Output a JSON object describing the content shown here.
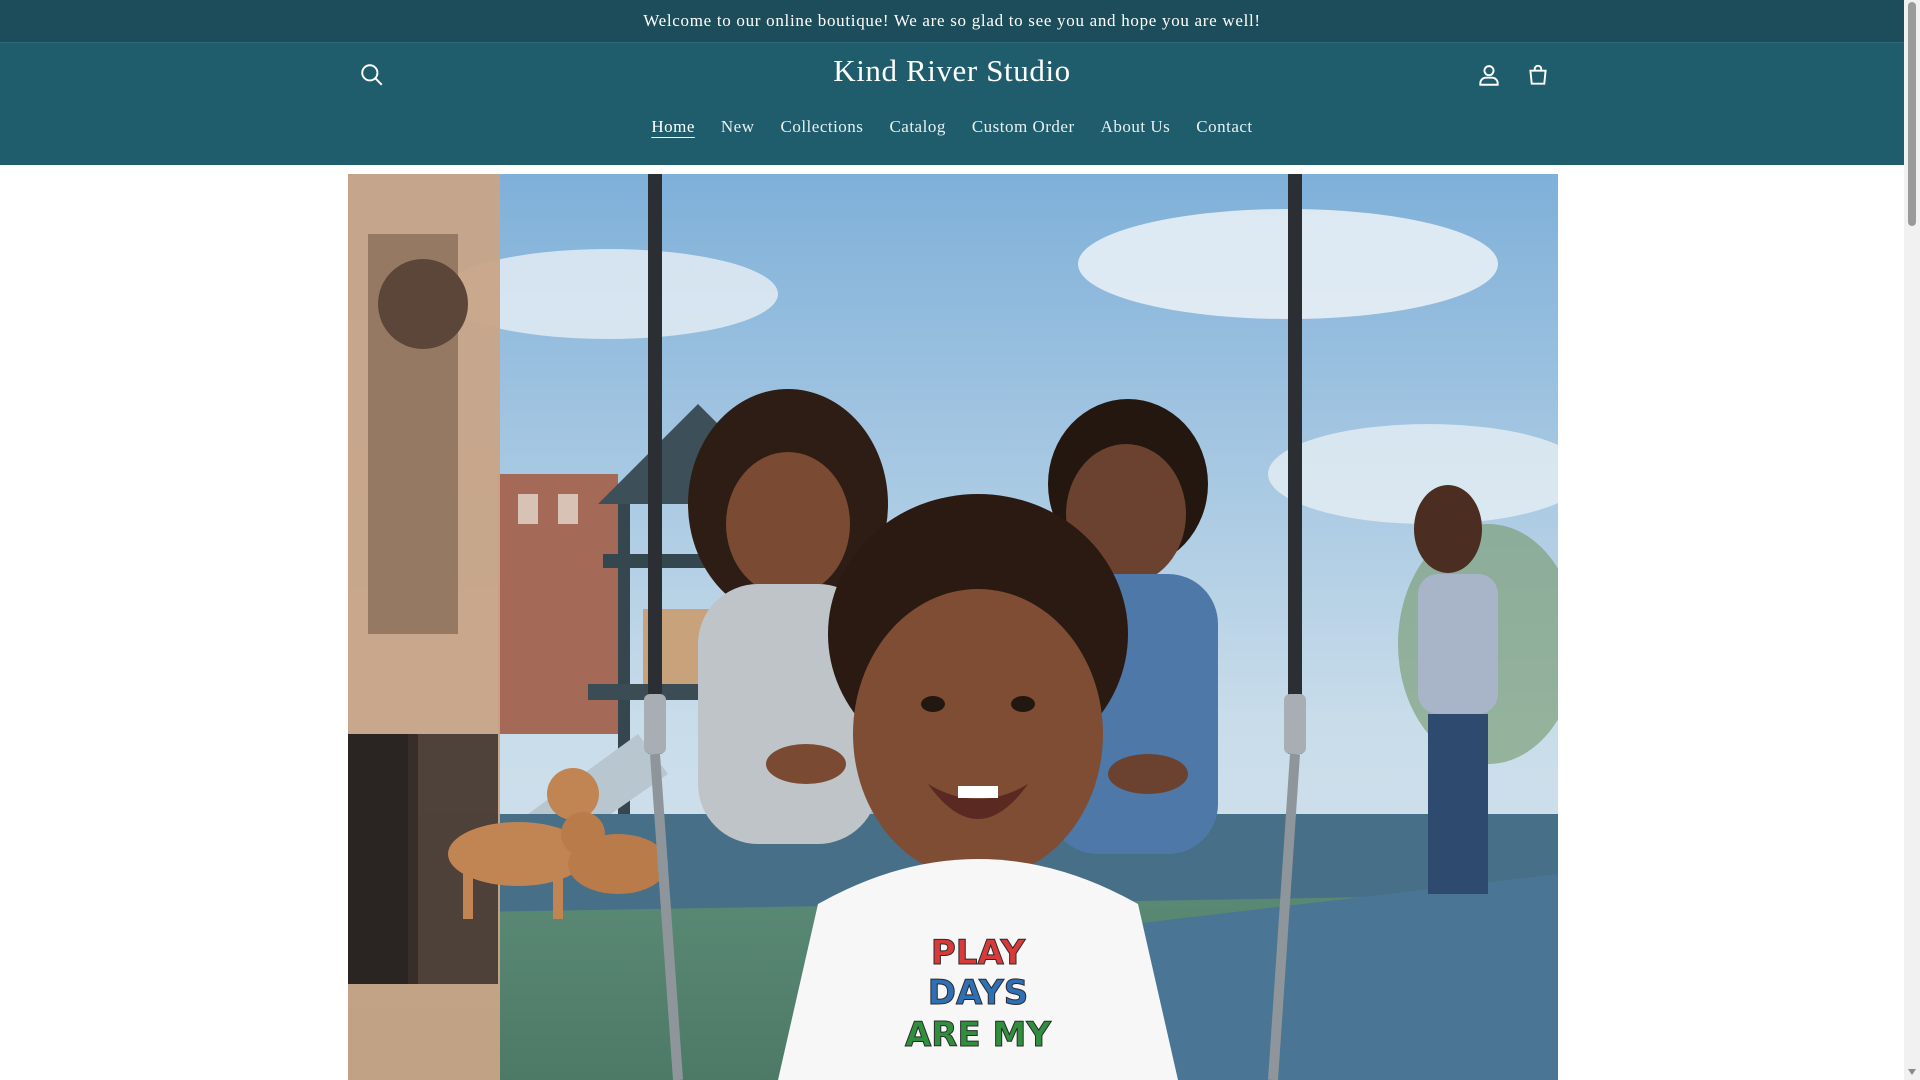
{
  "announcement": {
    "text": "Welcome to our online boutique! We are so glad to see you and hope you are well!"
  },
  "header": {
    "brand": "Kind River Studio",
    "icons": {
      "search": "search-icon",
      "account": "account-icon",
      "cart": "cart-icon"
    }
  },
  "nav": {
    "items": [
      {
        "label": "Home",
        "active": true
      },
      {
        "label": "New"
      },
      {
        "label": "Collections"
      },
      {
        "label": "Catalog"
      },
      {
        "label": "Custom Order"
      },
      {
        "label": "About Us"
      },
      {
        "label": "Contact"
      }
    ]
  },
  "hero": {
    "shirt_text": [
      "PLAY",
      "DAYS",
      "ARE MY"
    ]
  },
  "colors": {
    "announcement_bg": "#1d4d5b",
    "header_bg": "#1f5d6c",
    "text_on_dark": "#ffffff"
  }
}
